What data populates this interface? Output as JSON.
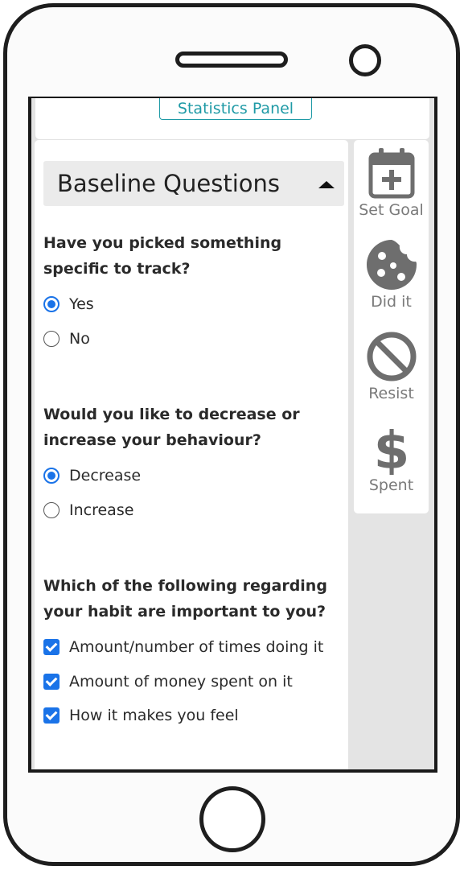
{
  "top": {
    "statistics_label": "Statistics Panel"
  },
  "section": {
    "title": "Baseline Questions"
  },
  "questions": [
    {
      "text": "Have you picked something specific to track?",
      "options": [
        {
          "label": "Yes",
          "selected": true
        },
        {
          "label": "No",
          "selected": false
        }
      ]
    },
    {
      "text": "Would you like to decrease or increase your behaviour?",
      "options": [
        {
          "label": "Decrease",
          "selected": true
        },
        {
          "label": "Increase",
          "selected": false
        }
      ]
    },
    {
      "text": "Which of the following regarding your habit are important to you?",
      "options": [
        {
          "label": "Amount/number of times doing it",
          "checked": true
        },
        {
          "label": "Amount of money spent on it",
          "checked": true
        },
        {
          "label": "How it makes you feel",
          "checked": true
        }
      ]
    }
  ],
  "sidebar": {
    "items": [
      {
        "label": "Set Goal",
        "icon": "calendar-plus-icon"
      },
      {
        "label": "Did it",
        "icon": "cookie-icon"
      },
      {
        "label": "Resist",
        "icon": "ban-icon"
      },
      {
        "label": "Spent",
        "icon": "dollar-icon"
      }
    ]
  },
  "colors": {
    "accent": "#1a73e8",
    "teal": "#1f9aa6",
    "icon_gray": "#6e6e6e"
  }
}
